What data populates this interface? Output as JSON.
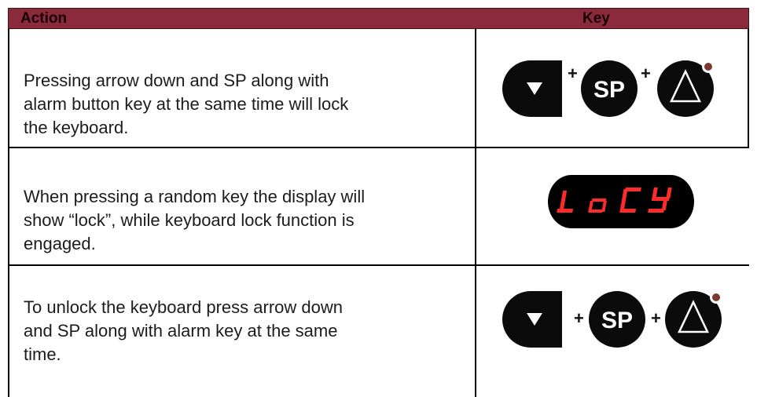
{
  "table": {
    "header": {
      "action": "Action",
      "key": "Key"
    },
    "rows": [
      {
        "action": "Pressing arrow down and SP along with alarm button key at the same time will lock the keyboard.",
        "keys": {
          "plus": "+",
          "sp_label": "SP"
        }
      },
      {
        "action": "When pressing a random key the display will show “lock”, while keyboard lock function is engaged.",
        "display": {
          "text": "LoCY",
          "digit_color": "#ff2a2a",
          "background": "#000000"
        }
      },
      {
        "action": "To unlock the keyboard press arrow down and SP along with alarm key at the same time.",
        "keys": {
          "plus": "+",
          "sp_label": "SP"
        }
      }
    ]
  },
  "colors": {
    "header_bg": "#8a2a3b",
    "button_bg": "#0b0b0b",
    "button_fg": "#ffffff"
  },
  "icons": [
    "arrow-down-icon",
    "plus-icon",
    "sp-button-icon",
    "alarm-triangle-icon"
  ]
}
